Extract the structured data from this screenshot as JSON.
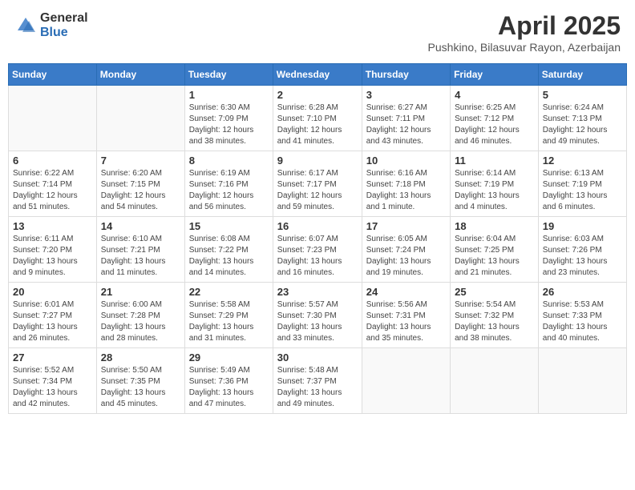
{
  "header": {
    "logo_general": "General",
    "logo_blue": "Blue",
    "month_title": "April 2025",
    "subtitle": "Pushkino, Bilasuvar Rayon, Azerbaijan"
  },
  "weekdays": [
    "Sunday",
    "Monday",
    "Tuesday",
    "Wednesday",
    "Thursday",
    "Friday",
    "Saturday"
  ],
  "weeks": [
    [
      {
        "day": "",
        "info": ""
      },
      {
        "day": "",
        "info": ""
      },
      {
        "day": "1",
        "info": "Sunrise: 6:30 AM\nSunset: 7:09 PM\nDaylight: 12 hours and 38 minutes."
      },
      {
        "day": "2",
        "info": "Sunrise: 6:28 AM\nSunset: 7:10 PM\nDaylight: 12 hours and 41 minutes."
      },
      {
        "day": "3",
        "info": "Sunrise: 6:27 AM\nSunset: 7:11 PM\nDaylight: 12 hours and 43 minutes."
      },
      {
        "day": "4",
        "info": "Sunrise: 6:25 AM\nSunset: 7:12 PM\nDaylight: 12 hours and 46 minutes."
      },
      {
        "day": "5",
        "info": "Sunrise: 6:24 AM\nSunset: 7:13 PM\nDaylight: 12 hours and 49 minutes."
      }
    ],
    [
      {
        "day": "6",
        "info": "Sunrise: 6:22 AM\nSunset: 7:14 PM\nDaylight: 12 hours and 51 minutes."
      },
      {
        "day": "7",
        "info": "Sunrise: 6:20 AM\nSunset: 7:15 PM\nDaylight: 12 hours and 54 minutes."
      },
      {
        "day": "8",
        "info": "Sunrise: 6:19 AM\nSunset: 7:16 PM\nDaylight: 12 hours and 56 minutes."
      },
      {
        "day": "9",
        "info": "Sunrise: 6:17 AM\nSunset: 7:17 PM\nDaylight: 12 hours and 59 minutes."
      },
      {
        "day": "10",
        "info": "Sunrise: 6:16 AM\nSunset: 7:18 PM\nDaylight: 13 hours and 1 minute."
      },
      {
        "day": "11",
        "info": "Sunrise: 6:14 AM\nSunset: 7:19 PM\nDaylight: 13 hours and 4 minutes."
      },
      {
        "day": "12",
        "info": "Sunrise: 6:13 AM\nSunset: 7:19 PM\nDaylight: 13 hours and 6 minutes."
      }
    ],
    [
      {
        "day": "13",
        "info": "Sunrise: 6:11 AM\nSunset: 7:20 PM\nDaylight: 13 hours and 9 minutes."
      },
      {
        "day": "14",
        "info": "Sunrise: 6:10 AM\nSunset: 7:21 PM\nDaylight: 13 hours and 11 minutes."
      },
      {
        "day": "15",
        "info": "Sunrise: 6:08 AM\nSunset: 7:22 PM\nDaylight: 13 hours and 14 minutes."
      },
      {
        "day": "16",
        "info": "Sunrise: 6:07 AM\nSunset: 7:23 PM\nDaylight: 13 hours and 16 minutes."
      },
      {
        "day": "17",
        "info": "Sunrise: 6:05 AM\nSunset: 7:24 PM\nDaylight: 13 hours and 19 minutes."
      },
      {
        "day": "18",
        "info": "Sunrise: 6:04 AM\nSunset: 7:25 PM\nDaylight: 13 hours and 21 minutes."
      },
      {
        "day": "19",
        "info": "Sunrise: 6:03 AM\nSunset: 7:26 PM\nDaylight: 13 hours and 23 minutes."
      }
    ],
    [
      {
        "day": "20",
        "info": "Sunrise: 6:01 AM\nSunset: 7:27 PM\nDaylight: 13 hours and 26 minutes."
      },
      {
        "day": "21",
        "info": "Sunrise: 6:00 AM\nSunset: 7:28 PM\nDaylight: 13 hours and 28 minutes."
      },
      {
        "day": "22",
        "info": "Sunrise: 5:58 AM\nSunset: 7:29 PM\nDaylight: 13 hours and 31 minutes."
      },
      {
        "day": "23",
        "info": "Sunrise: 5:57 AM\nSunset: 7:30 PM\nDaylight: 13 hours and 33 minutes."
      },
      {
        "day": "24",
        "info": "Sunrise: 5:56 AM\nSunset: 7:31 PM\nDaylight: 13 hours and 35 minutes."
      },
      {
        "day": "25",
        "info": "Sunrise: 5:54 AM\nSunset: 7:32 PM\nDaylight: 13 hours and 38 minutes."
      },
      {
        "day": "26",
        "info": "Sunrise: 5:53 AM\nSunset: 7:33 PM\nDaylight: 13 hours and 40 minutes."
      }
    ],
    [
      {
        "day": "27",
        "info": "Sunrise: 5:52 AM\nSunset: 7:34 PM\nDaylight: 13 hours and 42 minutes."
      },
      {
        "day": "28",
        "info": "Sunrise: 5:50 AM\nSunset: 7:35 PM\nDaylight: 13 hours and 45 minutes."
      },
      {
        "day": "29",
        "info": "Sunrise: 5:49 AM\nSunset: 7:36 PM\nDaylight: 13 hours and 47 minutes."
      },
      {
        "day": "30",
        "info": "Sunrise: 5:48 AM\nSunset: 7:37 PM\nDaylight: 13 hours and 49 minutes."
      },
      {
        "day": "",
        "info": ""
      },
      {
        "day": "",
        "info": ""
      },
      {
        "day": "",
        "info": ""
      }
    ]
  ]
}
